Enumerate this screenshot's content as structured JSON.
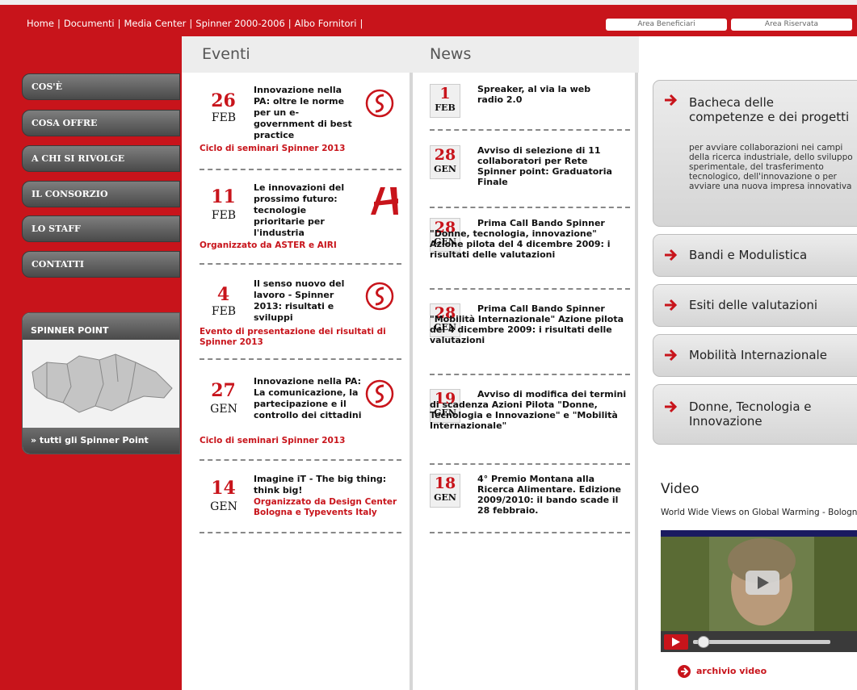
{
  "topnav": {
    "items": [
      "Home",
      "Documenti",
      "Media Center",
      "Spinner 2000-2006",
      "Albo Fornitori"
    ],
    "area_beneficiari": "Area Beneficiari",
    "area_riservata": "Area Riservata"
  },
  "sidebar": {
    "items": [
      {
        "label": "COS'È"
      },
      {
        "label": "COSA OFFRE"
      },
      {
        "label": "A CHI SI RIVOLGE"
      },
      {
        "label": "IL CONSORZIO"
      },
      {
        "label": "LO STAFF"
      },
      {
        "label": "CONTATTI"
      }
    ],
    "spinner_point_title": "SPINNER POINT",
    "spinner_point_link": "» tutti gli Spinner Point"
  },
  "events": {
    "title": "Eventi",
    "items": [
      {
        "day": "26",
        "month": "FEB",
        "title": "Innovazione nella PA: oltre le norme per un e-government di best practice",
        "sub": "Ciclo di seminari Spinner 2013"
      },
      {
        "day": "11",
        "month": "FEB",
        "title": "Le innovazioni del prossimo futuro: tecnologie prioritarie per l'industria",
        "sub": "Organizzato da ASTER e AIRI"
      },
      {
        "day": "4",
        "month": "FEB",
        "title": "Il senso nuovo del lavoro - Spinner 2013: risultati e sviluppi",
        "sub": "Evento di presentazione dei risultati di Spinner 2013"
      },
      {
        "day": "27",
        "month": "GEN",
        "title": "Innovazione nella PA: La comunicazione, la partecipazione e il controllo dei cittadini",
        "sub": "Ciclo di seminari Spinner 2013"
      },
      {
        "day": "14",
        "month": "GEN",
        "title": "Imagine iT - The big thing: think big!",
        "sub": "Organizzato da Design Center Bologna e Typevents Italy"
      }
    ]
  },
  "news": {
    "title": "News",
    "items": [
      {
        "day": "1",
        "month": "FEB",
        "title": "Spreaker, al via la web radio 2.0"
      },
      {
        "day": "28",
        "month": "GEN",
        "title": "Avviso di selezione di 11 collaboratori per Rete Spinner point: Graduatoria Finale"
      },
      {
        "day": "28",
        "month": "GEN",
        "title": "Prima Call Bando Spinner \"Donne, tecnologia, innovazione\" Azione pilota del 4 dicembre 2009: i risultati delle valutazioni"
      },
      {
        "day": "28",
        "month": "GEN",
        "title": "Prima Call Bando Spinner \"Mobilità Internazionale\" Azione pilota del 4 dicembre 2009: i risultati delle valutazioni"
      },
      {
        "day": "19",
        "month": "GEN",
        "title": "Avviso di modifica dei termini di scadenza Azioni Pilota \"Donne, Tecnologia e Innovazione\" e \"Mobilità Internazionale\""
      },
      {
        "day": "18",
        "month": "GEN",
        "title": "4° Premio Montana alla Ricerca Alimentare. Edizione 2009/2010: il bando scade il 28 febbraio."
      }
    ]
  },
  "right": {
    "boxes": [
      {
        "label": "Bacheca delle competenze e dei progetti",
        "desc": "per avviare collaborazioni nei campi della ricerca industriale, dello sviluppo sperimentale, del trasferimento tecnologico, dell'innovazione o per avviare una nuova impresa innovativa"
      },
      {
        "label": "Bandi e Modulistica"
      },
      {
        "label": "Esiti delle valutazioni"
      },
      {
        "label": "Mobilità Internazionale"
      },
      {
        "label": "Donne, Tecnologia e Innovazione"
      }
    ],
    "video_title": "Video",
    "video_caption": "World Wide Views on Global Warming - Bologna",
    "video_archive": "archivio video"
  },
  "colors": {
    "brand_red": "#c8141b",
    "menu_gray": "#5a5a5a"
  }
}
